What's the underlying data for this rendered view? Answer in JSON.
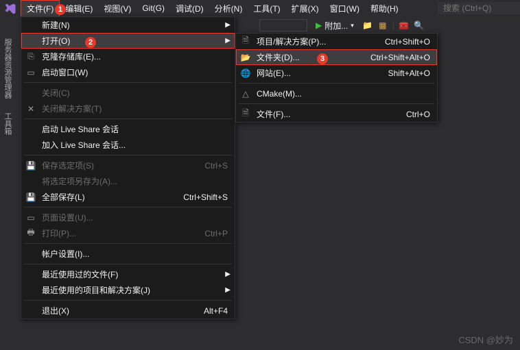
{
  "menubar": {
    "items": [
      "文件(F)",
      "编辑(E)",
      "视图(V)",
      "Git(G)",
      "调试(D)",
      "分析(N)",
      "工具(T)",
      "扩展(X)",
      "窗口(W)",
      "帮助(H)"
    ],
    "search_placeholder": "搜索 (Ctrl+Q)"
  },
  "toolbar": {
    "run_label": "附加..."
  },
  "left_tabs": [
    "服务器资源管理器",
    "工具箱"
  ],
  "badges": {
    "b1": "1",
    "b2": "2",
    "b3": "3"
  },
  "file_menu": [
    {
      "label": "新建(N)",
      "arrow": true
    },
    {
      "label": "打开(O)",
      "arrow": true,
      "active": true,
      "boxed": true,
      "badge": "b2"
    },
    {
      "label": "克隆存储库(E)...",
      "icon": "clone"
    },
    {
      "label": "启动窗口(W)",
      "icon": "start"
    },
    {
      "sep": true
    },
    {
      "label": "关闭(C)",
      "disabled": true
    },
    {
      "label": "关闭解决方案(T)",
      "disabled": true,
      "icon": "close-sln"
    },
    {
      "sep": true
    },
    {
      "label": "启动 Live Share 会话"
    },
    {
      "label": "加入 Live Share 会话..."
    },
    {
      "sep": true
    },
    {
      "label": "保存选定项(S)",
      "shortcut": "Ctrl+S",
      "disabled": true,
      "icon": "save"
    },
    {
      "label": "将选定项另存为(A)...",
      "disabled": true
    },
    {
      "label": "全部保存(L)",
      "shortcut": "Ctrl+Shift+S",
      "icon": "save-all"
    },
    {
      "sep": true
    },
    {
      "label": "页面设置(U)...",
      "disabled": true,
      "icon": "page"
    },
    {
      "label": "打印(P)...",
      "shortcut": "Ctrl+P",
      "disabled": true,
      "icon": "print"
    },
    {
      "sep": true
    },
    {
      "label": "帐户设置(I)..."
    },
    {
      "sep": true
    },
    {
      "label": "最近使用过的文件(F)",
      "arrow": true
    },
    {
      "label": "最近使用的项目和解决方案(J)",
      "arrow": true
    },
    {
      "sep": true
    },
    {
      "label": "退出(X)",
      "shortcut": "Alt+F4"
    }
  ],
  "open_submenu": [
    {
      "label": "项目/解决方案(P)...",
      "shortcut": "Ctrl+Shift+O",
      "icon": "project"
    },
    {
      "label": "文件夹(D)...",
      "shortcut": "Ctrl+Shift+Alt+O",
      "icon": "folder",
      "active": true,
      "boxed": true,
      "badge": "b3"
    },
    {
      "label": "网站(E)...",
      "shortcut": "Shift+Alt+O",
      "icon": "website"
    },
    {
      "sep": true
    },
    {
      "label": "CMake(M)...",
      "icon": "cmake"
    },
    {
      "sep": true
    },
    {
      "label": "文件(F)...",
      "shortcut": "Ctrl+O",
      "icon": "file"
    }
  ],
  "watermark": "CSDN @妙为"
}
